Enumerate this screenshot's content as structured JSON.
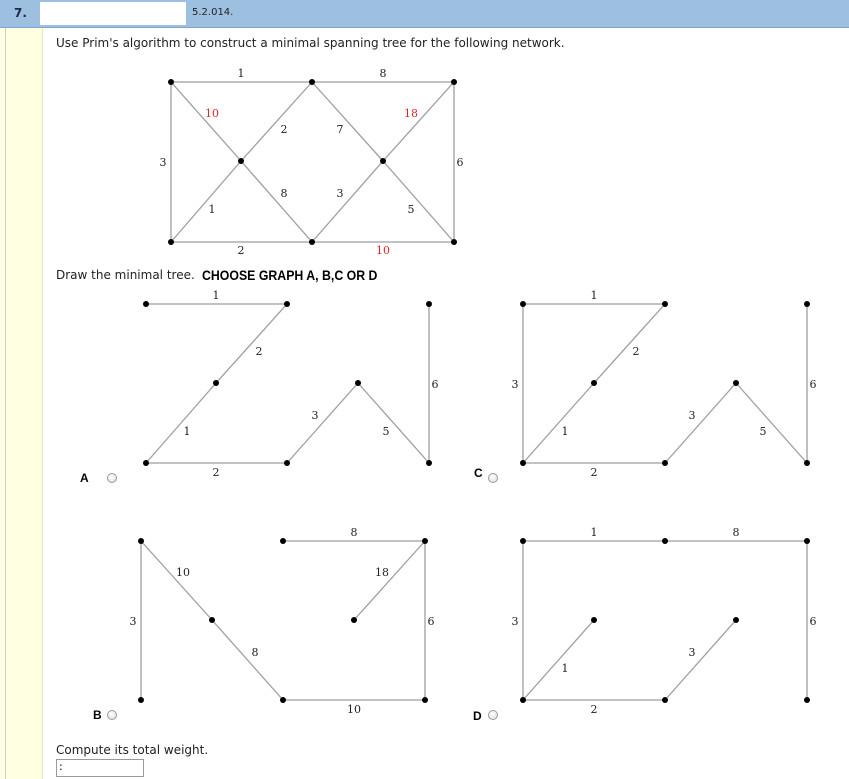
{
  "header": {
    "question_number": "7.",
    "section": "5.2.014."
  },
  "question": {
    "prompt": "Use Prim's algorithm to construct a minimal spanning tree for the following network.",
    "draw_label": "Draw the minimal tree.",
    "choose_label": "CHOOSE GRAPH A, B,C OR D",
    "total_label": "Compute its total weight.",
    "answer_value": ":"
  },
  "network": {
    "edges": [
      {
        "w": "1",
        "red": false
      },
      {
        "w": "8",
        "red": false
      },
      {
        "w": "10",
        "red": true
      },
      {
        "w": "18",
        "red": true
      },
      {
        "w": "2",
        "red": false
      },
      {
        "w": "7",
        "red": false
      },
      {
        "w": "3",
        "red": false
      },
      {
        "w": "6",
        "red": false
      },
      {
        "w": "1",
        "red": false
      },
      {
        "w": "8",
        "red": false
      },
      {
        "w": "3",
        "red": false
      },
      {
        "w": "5",
        "red": false
      },
      {
        "w": "2",
        "red": false
      },
      {
        "w": "10",
        "red": true
      }
    ]
  },
  "options": {
    "A": {
      "label": "A",
      "weights": [
        "1",
        "2",
        "1",
        "2",
        "3",
        "5",
        "6"
      ]
    },
    "B": {
      "label": "B",
      "weights": [
        "8",
        "10",
        "18",
        "3",
        "8",
        "6",
        "10"
      ]
    },
    "C": {
      "label": "C",
      "weights": [
        "1",
        "2",
        "3",
        "1",
        "2",
        "3",
        "5",
        "6"
      ]
    },
    "D": {
      "label": "D",
      "weights": [
        "1",
        "8",
        "3",
        "1",
        "3",
        "6",
        "2"
      ]
    }
  },
  "colors": {
    "header_bar": "#9dbfe0",
    "margin": "#ffffe1",
    "highlight_weight": "#e0242b"
  }
}
